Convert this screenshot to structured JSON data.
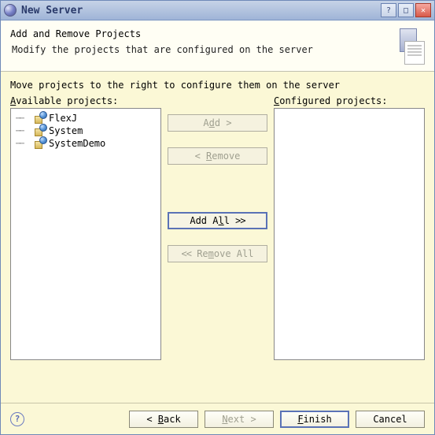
{
  "window": {
    "title": "New Server"
  },
  "header": {
    "title": "Add and Remove Projects",
    "subtitle": "Modify the projects that are configured on the server"
  },
  "content": {
    "instructions": "Move projects to the right to configure them on the server",
    "available_label_u": "A",
    "available_label_rest": "vailable projects:",
    "configured_label_u": "C",
    "configured_label_rest": "onfigured projects:",
    "available": [
      "FlexJ",
      "System",
      "SystemDemo"
    ],
    "configured": []
  },
  "buttons": {
    "add_u": "d",
    "add_pre": "A",
    "add_post": "d >",
    "remove": "< Remove",
    "remove_u": "R",
    "addall_pre": "Add A",
    "addall_u": "l",
    "addall_post": "l >>",
    "removeall_pre": "<< Re",
    "removeall_u": "m",
    "removeall_post": "ove All"
  },
  "nav": {
    "back_pre": "< ",
    "back_u": "B",
    "back_post": "ack",
    "next_u": "N",
    "next_post": "ext >",
    "finish_u": "F",
    "finish_post": "inish",
    "cancel": "Cancel"
  }
}
